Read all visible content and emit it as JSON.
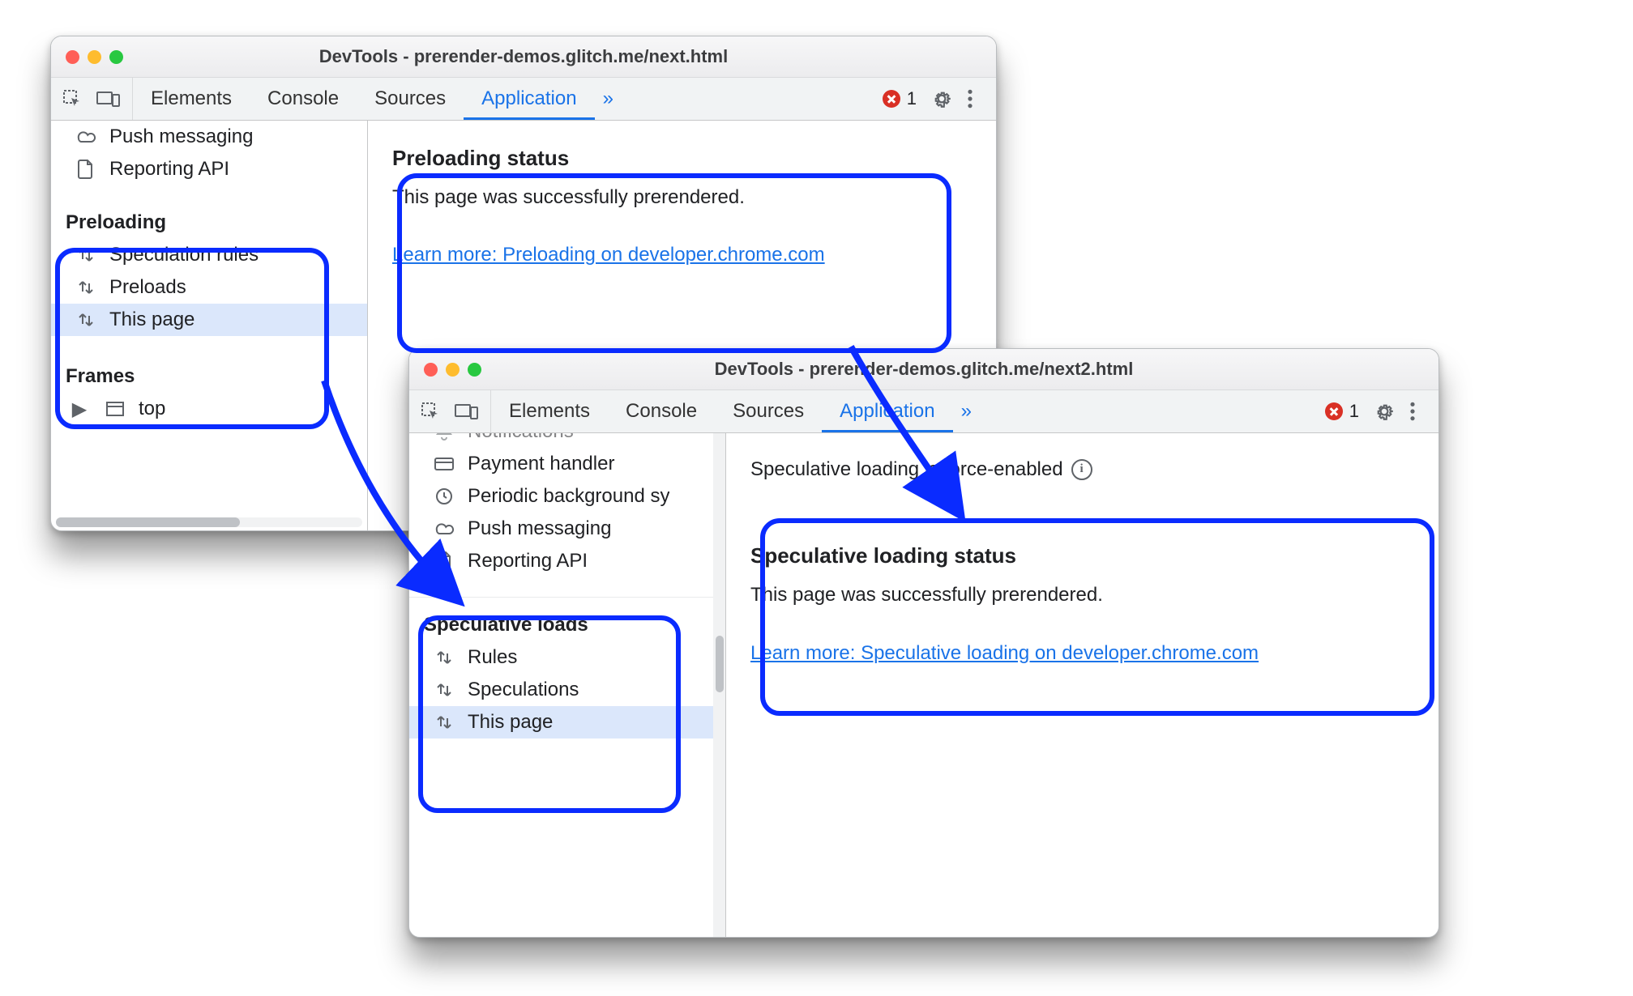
{
  "highlight_color": "#0a2bff",
  "window1": {
    "title": "DevTools - prerender-demos.glitch.me/next.html",
    "tabs": [
      "Elements",
      "Console",
      "Sources",
      "Application"
    ],
    "tabs_active_index": 3,
    "more_label": "»",
    "error_count": "1",
    "sidebar": {
      "top_items": [
        {
          "icon": "cloud",
          "label": "Push messaging"
        },
        {
          "icon": "doc",
          "label": "Reporting API"
        }
      ],
      "section_title": "Preloading",
      "items": [
        {
          "icon": "updn",
          "label": "Speculation rules",
          "selected": false
        },
        {
          "icon": "updn",
          "label": "Preloads",
          "selected": false
        },
        {
          "icon": "updn",
          "label": "This page",
          "selected": true
        }
      ],
      "frames_title": "Frames",
      "frames_item": "top"
    },
    "main": {
      "title": "Preloading status",
      "desc": "This page was successfully prerendered.",
      "link": "Learn more: Preloading on developer.chrome.com"
    }
  },
  "window2": {
    "title": "DevTools - prerender-demos.glitch.me/next2.html",
    "tabs": [
      "Elements",
      "Console",
      "Sources",
      "Application"
    ],
    "tabs_active_index": 3,
    "more_label": "»",
    "error_count": "1",
    "sidebar": {
      "top_items": [
        {
          "icon": "bell",
          "label": "Notifications"
        },
        {
          "icon": "card",
          "label": "Payment handler"
        },
        {
          "icon": "clock",
          "label": "Periodic background sy"
        },
        {
          "icon": "cloud",
          "label": "Push messaging"
        },
        {
          "icon": "doc",
          "label": "Reporting API"
        }
      ],
      "section_title": "Speculative loads",
      "items": [
        {
          "icon": "updn",
          "label": "Rules",
          "selected": false
        },
        {
          "icon": "updn",
          "label": "Speculations",
          "selected": false
        },
        {
          "icon": "updn",
          "label": "This page",
          "selected": true
        }
      ]
    },
    "main": {
      "top_info": "Speculative loading is force-enabled",
      "title": "Speculative loading status",
      "desc": "This page was successfully prerendered.",
      "link": "Learn more: Speculative loading on developer.chrome.com"
    }
  }
}
